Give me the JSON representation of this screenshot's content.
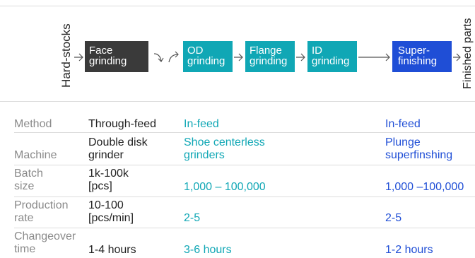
{
  "flow": {
    "start_label": "Hard-stocks",
    "end_label": "Finished parts",
    "steps": [
      {
        "lines": [
          "Face",
          "grinding"
        ]
      },
      {
        "lines": [
          "OD",
          "grinding"
        ]
      },
      {
        "lines": [
          "Flange",
          "grinding"
        ]
      },
      {
        "lines": [
          "ID",
          "grinding"
        ]
      },
      {
        "lines": [
          "Super-",
          "finishing"
        ]
      }
    ],
    "colors": {
      "dark": "#3a3a3a",
      "teal": "#10a7b5",
      "blue": "#1f4ed6"
    }
  },
  "table": {
    "rows": [
      {
        "label": [
          "Method"
        ],
        "face": [
          "Through-feed"
        ],
        "grind": [
          "In-feed"
        ],
        "super": [
          "In-feed"
        ]
      },
      {
        "label": [
          "Machine"
        ],
        "face": [
          "Double disk",
          "grinder"
        ],
        "grind": [
          "Shoe centerless",
          "grinders"
        ],
        "super": [
          "Plunge",
          "superfinshing"
        ]
      },
      {
        "label": [
          "Batch",
          "size"
        ],
        "face": [
          "1k-100k",
          "[pcs]"
        ],
        "grind": [
          "1,000 – 100,000"
        ],
        "super": [
          "1,000 –100,000"
        ]
      },
      {
        "label": [
          "Production",
          "rate"
        ],
        "face": [
          "10-100",
          "[pcs/min]"
        ],
        "grind": [
          "2-5"
        ],
        "super": [
          "2-5"
        ]
      },
      {
        "label": [
          "Changeover",
          "time"
        ],
        "face": [
          "1-4 hours"
        ],
        "grind": [
          "3-6 hours"
        ],
        "super": [
          "1-2 hours"
        ]
      }
    ]
  }
}
